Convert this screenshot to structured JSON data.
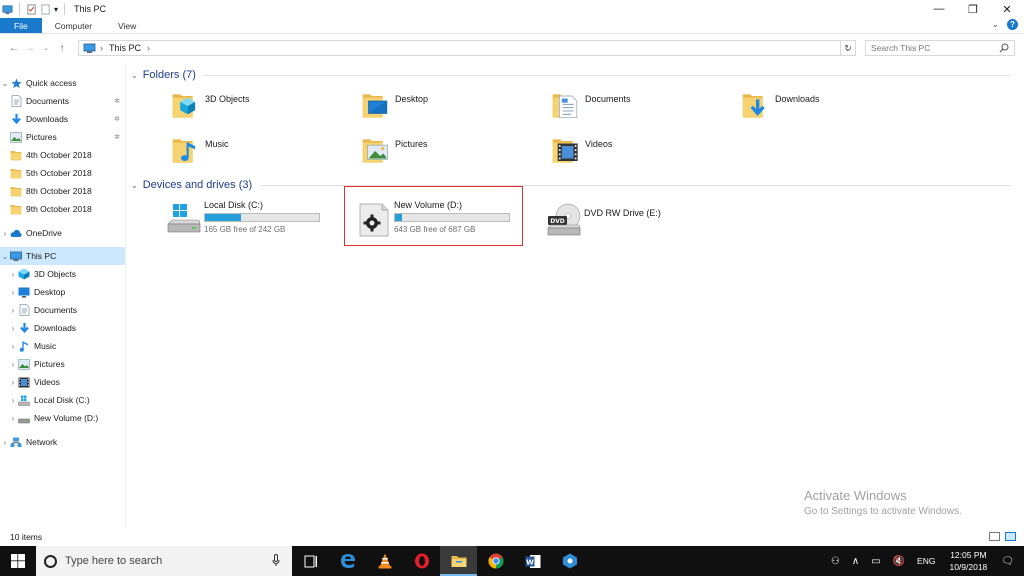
{
  "window": {
    "title": "This PC",
    "ribbon_tabs": [
      "File",
      "Computer",
      "View"
    ]
  },
  "address": {
    "path": "This PC",
    "search_placeholder": "Search This PC"
  },
  "sidebar": {
    "quick_access": {
      "label": "Quick access"
    },
    "quick_items": [
      {
        "label": "Documents",
        "icon": "documents-icon",
        "pinned": true
      },
      {
        "label": "Downloads",
        "icon": "downloads-icon",
        "pinned": true
      },
      {
        "label": "Pictures",
        "icon": "pictures-icon",
        "pinned": true
      },
      {
        "label": "4th October 2018",
        "icon": "folder-icon",
        "pinned": false
      },
      {
        "label": "5th October 2018",
        "icon": "folder-icon",
        "pinned": false
      },
      {
        "label": "8th October 2018",
        "icon": "folder-icon",
        "pinned": false
      },
      {
        "label": "9th October 2018",
        "icon": "folder-icon",
        "pinned": false
      }
    ],
    "onedrive": {
      "label": "OneDrive"
    },
    "this_pc": {
      "label": "This PC"
    },
    "pc_items": [
      {
        "label": "3D Objects",
        "icon": "3d-objects-icon"
      },
      {
        "label": "Desktop",
        "icon": "desktop-icon"
      },
      {
        "label": "Documents",
        "icon": "documents-icon"
      },
      {
        "label": "Downloads",
        "icon": "downloads-icon"
      },
      {
        "label": "Music",
        "icon": "music-icon"
      },
      {
        "label": "Pictures",
        "icon": "pictures-icon"
      },
      {
        "label": "Videos",
        "icon": "videos-icon"
      },
      {
        "label": "Local Disk (C:)",
        "icon": "local-disk-icon"
      },
      {
        "label": "New Volume (D:)",
        "icon": "drive-icon"
      }
    ],
    "network": {
      "label": "Network"
    }
  },
  "content": {
    "folders_header": "Folders (7)",
    "folders": [
      {
        "label": "3D Objects",
        "icon": "3d-objects-icon"
      },
      {
        "label": "Desktop",
        "icon": "desktop-icon"
      },
      {
        "label": "Documents",
        "icon": "documents-icon"
      },
      {
        "label": "Downloads",
        "icon": "downloads-icon"
      },
      {
        "label": "Music",
        "icon": "music-icon"
      },
      {
        "label": "Pictures",
        "icon": "pictures-icon"
      },
      {
        "label": "Videos",
        "icon": "videos-icon"
      }
    ],
    "drives_header": "Devices and drives (3)",
    "drives": [
      {
        "name": "Local Disk (C:)",
        "free": "165 GB free of 242 GB",
        "used_fraction": 0.32,
        "icon": "windows-drive-icon"
      },
      {
        "name": "New Volume (D:)",
        "free": "643 GB free of 687 GB",
        "used_fraction": 0.06,
        "icon": "gear-drive-icon"
      },
      {
        "name": "DVD RW Drive (E:)",
        "icon": "dvd-drive-icon"
      }
    ]
  },
  "status": {
    "items_count": "10 items"
  },
  "watermark": {
    "line1": "Activate Windows",
    "line2": "Go to Settings to activate Windows."
  },
  "taskbar": {
    "search_placeholder": "Type here to search",
    "apps": [
      "task-view-icon",
      "edge-icon",
      "vlc-icon",
      "opera-icon",
      "file-explorer-icon",
      "chrome-icon",
      "word-icon",
      "app-icon"
    ],
    "language": "ENG",
    "time": "12:05 PM",
    "date": "10/9/2018"
  },
  "colors": {
    "accent": "#1979ca",
    "selection": "#cce8ff",
    "drive_bar": "#26a0da",
    "highlight_box": "#e03030"
  }
}
